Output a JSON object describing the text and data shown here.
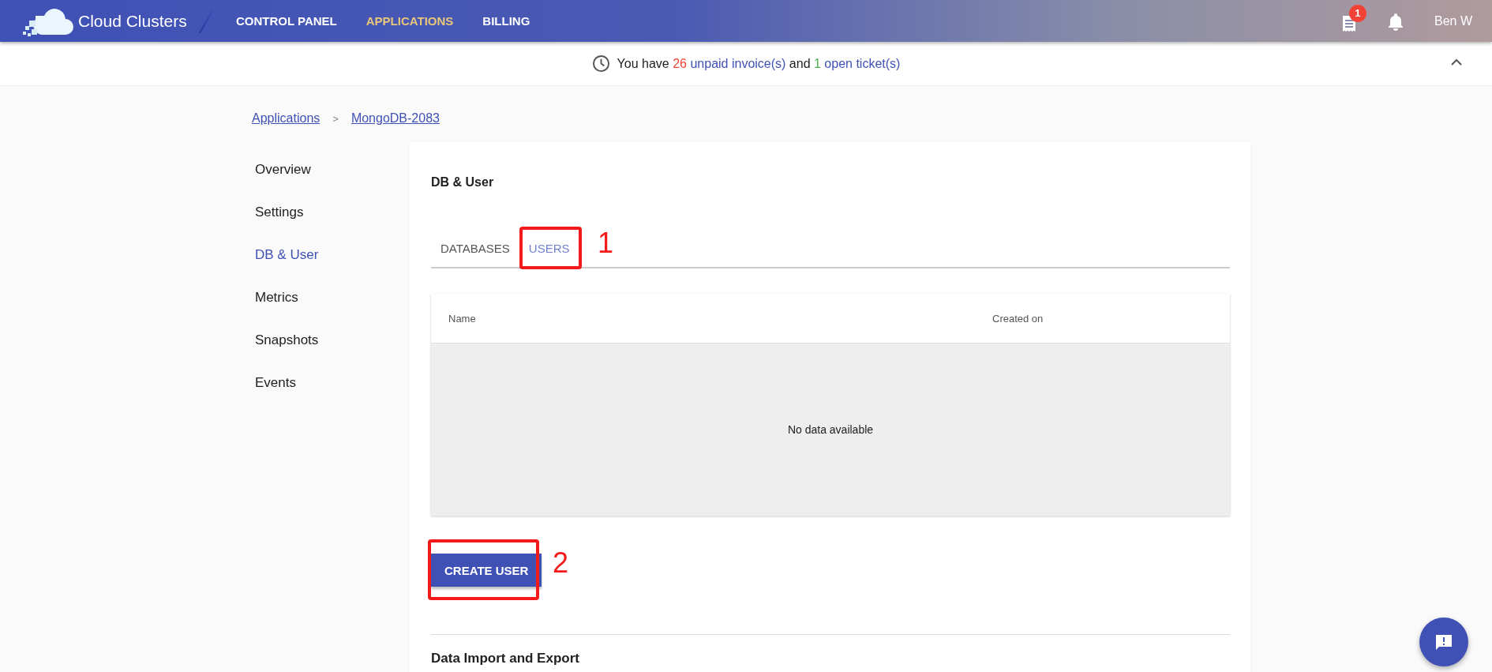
{
  "app": {
    "logo_text": "Cloud Clusters"
  },
  "nav": [
    {
      "label": "CONTROL PANEL",
      "selected": false
    },
    {
      "label": "APPLICATIONS",
      "selected": true
    },
    {
      "label": "BILLING",
      "selected": false
    }
  ],
  "user_area": {
    "invoice_badge": "1",
    "user_name": "Ben W"
  },
  "notice": {
    "expanded": true,
    "segments": [
      {
        "text": "You have",
        "kind": "plain"
      },
      {
        "text": "26",
        "kind": "alert"
      },
      {
        "text": "unpaid invoice(s)",
        "kind": "link"
      },
      {
        "text": "and",
        "kind": "plain"
      },
      {
        "text": "1",
        "kind": "ok"
      },
      {
        "text": "open ticket(s)",
        "kind": "link"
      }
    ]
  },
  "breadcrumb": {
    "items": [
      "Applications",
      "MongoDB-2083"
    ],
    "separator": ">"
  },
  "sidebar": {
    "items": [
      {
        "label": "Overview",
        "selected": false
      },
      {
        "label": "Settings",
        "selected": false
      },
      {
        "label": "DB & User",
        "selected": true
      },
      {
        "label": "Metrics",
        "selected": false
      },
      {
        "label": "Snapshots",
        "selected": false
      },
      {
        "label": "Events",
        "selected": false
      }
    ]
  },
  "section": {
    "title": "DB & User",
    "tabs": [
      {
        "label": "DATABASES",
        "selected": false
      },
      {
        "label": "USERS",
        "selected": true
      }
    ],
    "table": {
      "columns": [
        "Name",
        "Created on"
      ],
      "empty_text": "No data available"
    },
    "button": "CREATE USER"
  },
  "next_section": {
    "title": "Data Import and Export"
  },
  "annotations": [
    {
      "label": "1",
      "kind": "tab"
    },
    {
      "label": "2",
      "kind": "button"
    }
  ]
}
